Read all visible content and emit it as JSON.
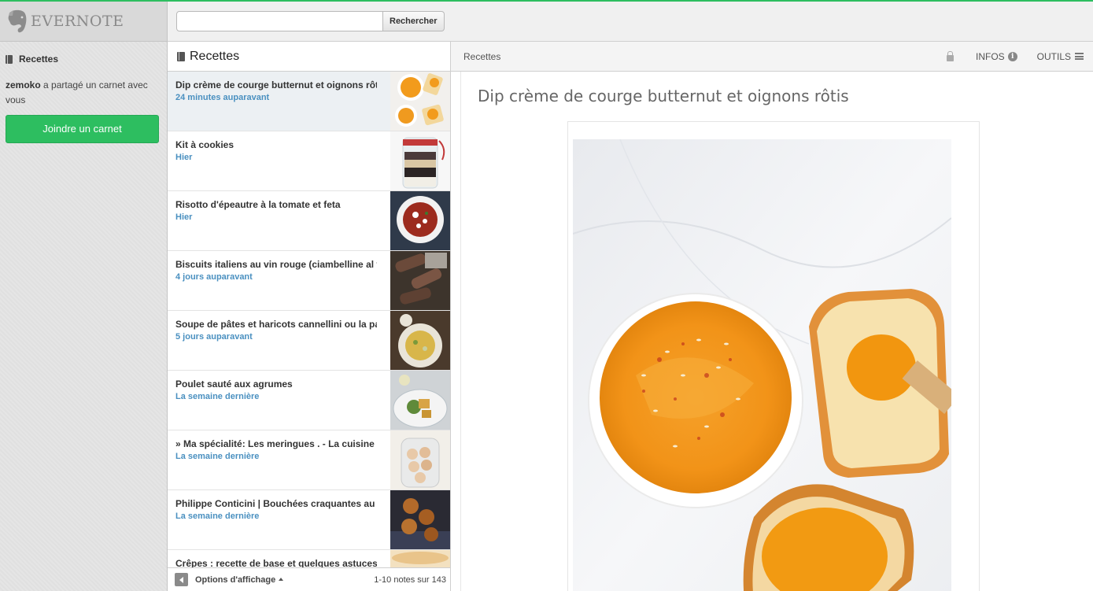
{
  "app": {
    "logo_text": "EVERNOTE",
    "accent_color": "#2dbe60",
    "link_color": "#4a90c0"
  },
  "search": {
    "value": "",
    "placeholder": "",
    "button_label": "Rechercher"
  },
  "sidebar": {
    "notebook_name": "Recettes",
    "shared_by": "zemoko",
    "share_text": " a partagé un carnet avec vous",
    "join_button": "Joindre un carnet"
  },
  "notelist": {
    "title": "Recettes",
    "notes": [
      {
        "title": "Dip crème de courge butternut et oignons rôtis",
        "date": "24 minutes auparavant",
        "thumb": "butternut-dip"
      },
      {
        "title": "Kit à cookies",
        "date": "Hier",
        "thumb": "cookie-jar"
      },
      {
        "title": "Risotto d'épeautre à la tomate et feta",
        "date": "Hier",
        "thumb": "risotto-bowl"
      },
      {
        "title": "Biscuits italiens au vin rouge (ciambelline al vino)",
        "date": "4 jours auparavant",
        "thumb": "biscuits"
      },
      {
        "title": "Soupe de pâtes et haricots cannellini ou la pasta e fagioli",
        "date": "5 jours auparavant",
        "thumb": "pasta-soup"
      },
      {
        "title": "Poulet sauté aux agrumes",
        "date": "La semaine dernière",
        "thumb": "chicken-plate"
      },
      {
        "title": "» Ma spécialité: Les meringues . - La cuisine",
        "date": "La semaine dernière",
        "thumb": "meringues"
      },
      {
        "title": "Philippe Conticini | Bouchées craquantes au chocolat",
        "date": "La semaine dernière",
        "thumb": "bouchees"
      },
      {
        "title": "Crêpes : recette de base et quelques astuces",
        "date": "",
        "thumb": "crepes"
      }
    ],
    "view_options": "Options d'affichage",
    "count": "1-10 notes sur 143"
  },
  "noteview": {
    "breadcrumb": "Recettes",
    "info_label": "INFOS",
    "tools_label": "OUTILS",
    "note_title": "Dip crème de courge butternut et oignons rôtis",
    "image": "butternut-dip-photo"
  }
}
